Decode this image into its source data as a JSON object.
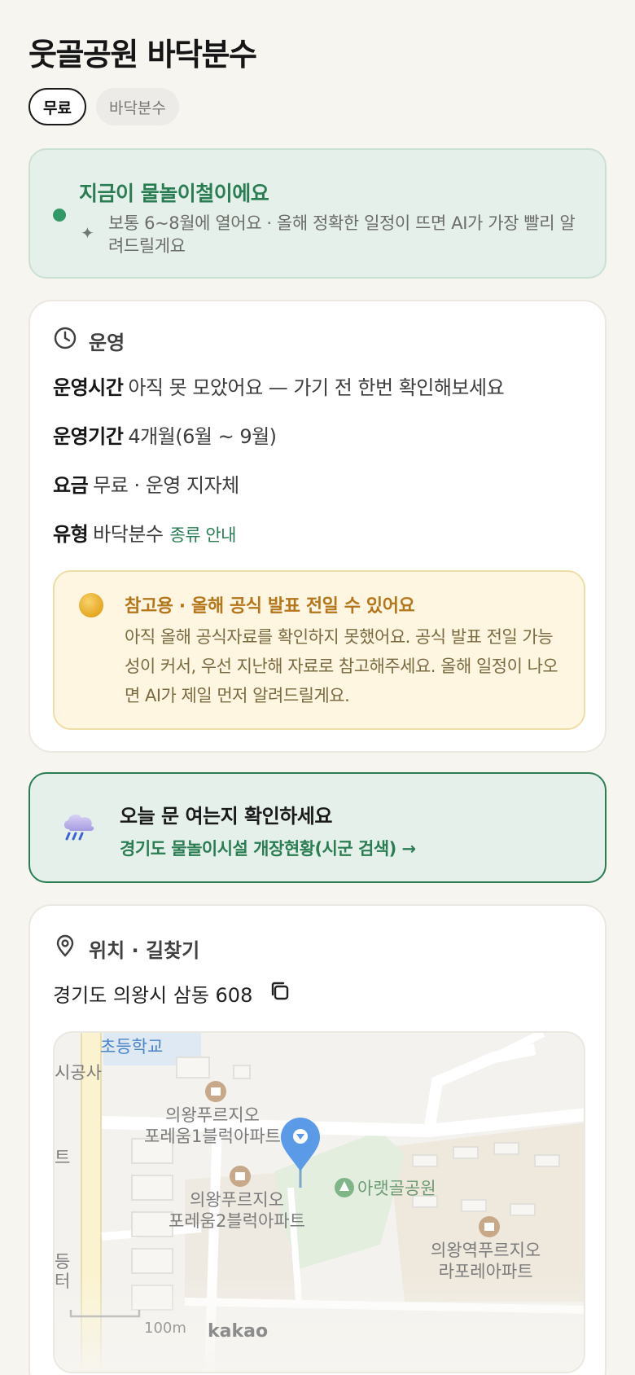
{
  "header": {
    "title": "웃골공원 바닥분수"
  },
  "tags": [
    {
      "label": "무료",
      "active": true
    },
    {
      "label": "바닥분수",
      "active": false
    }
  ],
  "season": {
    "title": "지금이 물놀이철이에요",
    "description": "보통 6~8월에 열어요 · 올해 정확한 일정이 뜨면 AI가 가장 빨리 알려드릴게요",
    "dot_color": "#2f9a65"
  },
  "operation": {
    "heading": "운영",
    "icon": "clock-icon",
    "rows": [
      {
        "label": "운영시간",
        "value": "아직 못 모았어요 — 가기 전 한번 확인해보세요"
      },
      {
        "label": "운영기간",
        "value": "4개월(6월 ~ 9월)"
      },
      {
        "label": "요금",
        "value": "무료 · 운영 지자체"
      },
      {
        "label": "유형",
        "value": "바닥분수",
        "link": "종류 안내"
      }
    ],
    "notice": {
      "title": "참고용 · 올해 공식 발표 전일 수 있어요",
      "body": "아직 올해 공식자료를 확인하지 못했어요. 공식 발표 전일 가능성이 커서, 우선 지난해 자료로 참고해주세요. 올해 일정이 나오면 AI가 제일 먼저 알려드릴게요."
    }
  },
  "check": {
    "title": "오늘 문 여는지 확인하세요",
    "link": "경기도 물놀이시설 개장현황(시군 검색) →",
    "icon": "rain-cloud-icon"
  },
  "location": {
    "heading": "위치 · 길찾기",
    "icon": "location-pin-icon",
    "address": "경기도 의왕시 삼동 608",
    "copy_icon": "copy-icon",
    "map": {
      "labels": {
        "school": "초등학교",
        "construction": "시공사",
        "apt1_line1": "의왕푸르지오",
        "apt1_line2": "포레움1블럭아파트",
        "apt2_line1": "의왕푸르지오",
        "apt2_line2": "포레움2블럭아파트",
        "park": "아랫골공원",
        "apt3_line1": "의왕역푸르지오",
        "apt3_line2": "라포레아파트",
        "edge1": "트",
        "edge2": "등",
        "edge3": "터"
      },
      "scale": "100m",
      "brand": "kakao"
    }
  }
}
